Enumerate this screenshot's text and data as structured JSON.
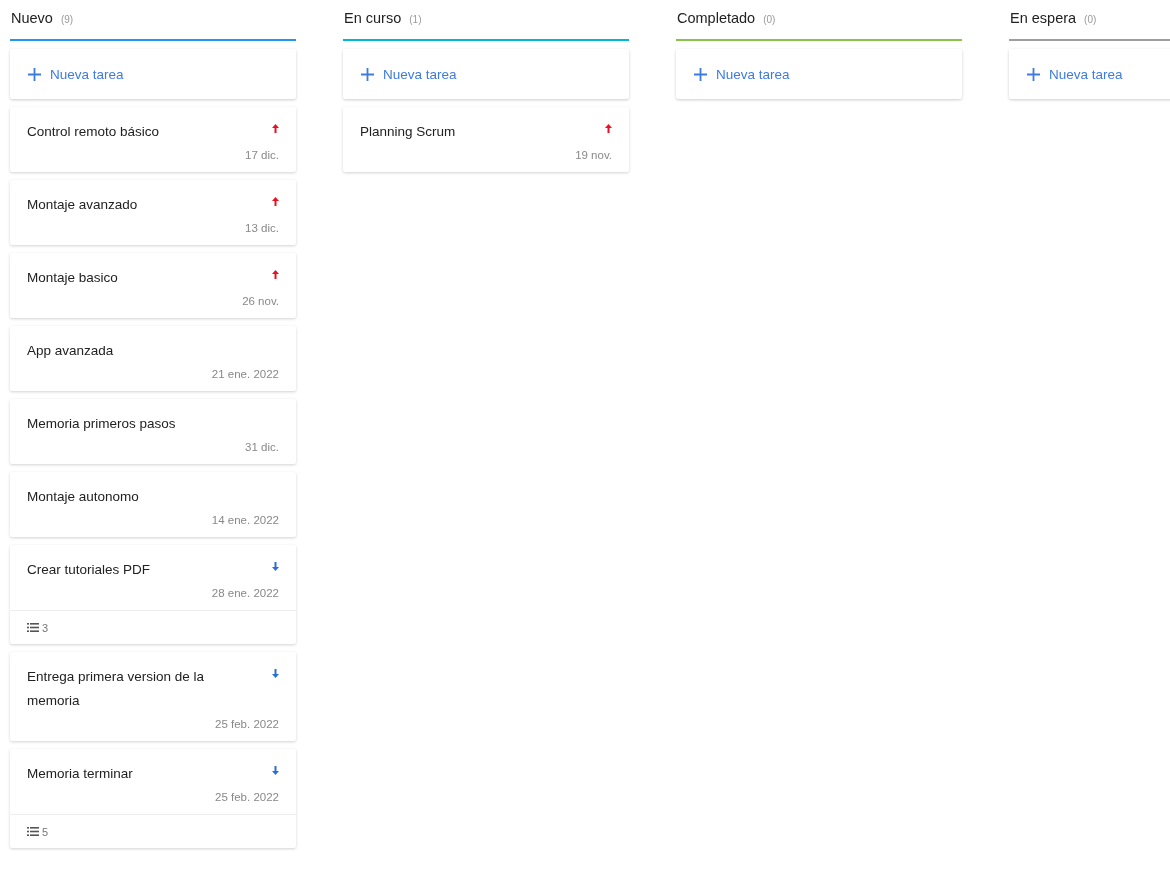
{
  "columns": [
    {
      "title": "Nuevo",
      "count": "(9)",
      "color": "#2196f3",
      "add_label": "Nueva tarea",
      "cards": [
        {
          "title": "Control remoto básico",
          "kind": "high",
          "date": "17 dic."
        },
        {
          "title": "Montaje avanzado",
          "kind": "high",
          "date": "13 dic."
        },
        {
          "title": "Montaje basico",
          "kind": "high",
          "date": "26 nov."
        },
        {
          "title": "App avanzada",
          "kind": "plain",
          "date": "21 ene. 2022"
        },
        {
          "title": "Memoria primeros pasos",
          "kind": "plain",
          "date": "31 dic."
        },
        {
          "title": "Montaje autonomo",
          "kind": "plain",
          "date": "14 ene. 2022"
        },
        {
          "title": "Crear tutoriales PDF",
          "kind": "low",
          "date": "28 ene. 2022",
          "checklist": "3"
        },
        {
          "title": "Entrega primera version de la memoria",
          "kind": "low",
          "date": "25 feb. 2022"
        },
        {
          "title": "Memoria terminar",
          "kind": "low",
          "date": "25 feb. 2022",
          "checklist": "5"
        }
      ]
    },
    {
      "title": "En curso",
      "count": "(1)",
      "color": "#00b7d4",
      "add_label": "Nueva tarea",
      "cards": [
        {
          "title": "Planning Scrum",
          "kind": "high",
          "date": "19 nov."
        }
      ]
    },
    {
      "title": "Completado",
      "count": "(0)",
      "color": "#8bc34a",
      "add_label": "Nueva tarea"
    },
    {
      "title": "En espera",
      "count": "(0)",
      "color": "#9e9e9e",
      "add_label": "Nueva tarea"
    }
  ]
}
